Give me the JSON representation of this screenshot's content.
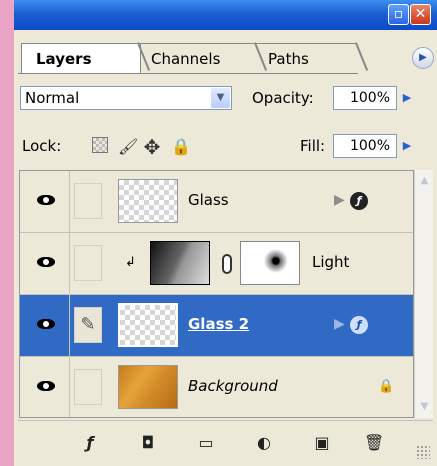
{
  "window": {
    "minimize_icon": "minimize-icon",
    "close_icon": "close-icon",
    "accent": "#0b4bc8"
  },
  "tabs": [
    {
      "label": "Layers",
      "active": true
    },
    {
      "label": "Channels",
      "active": false
    },
    {
      "label": "Paths",
      "active": false
    }
  ],
  "blend_mode": "Normal",
  "opacity": {
    "label": "Opacity:",
    "value": "100%"
  },
  "lock": {
    "label": "Lock:",
    "icons": [
      "lock-transparency-icon",
      "lock-pixels-icon",
      "lock-position-icon",
      "lock-all-icon"
    ]
  },
  "fill": {
    "label": "Fill:",
    "value": "100%"
  },
  "layers": [
    {
      "name": "Glass",
      "visible": true,
      "has_effects": true,
      "selected": false,
      "thumbnail": "transparent"
    },
    {
      "name": "Light",
      "visible": true,
      "has_effects": false,
      "selected": false,
      "thumbnail": "gradient",
      "mask": true,
      "clipped": true
    },
    {
      "name": "Glass 2",
      "visible": true,
      "has_effects": true,
      "selected": true,
      "thumbnail": "transparent",
      "brush_linked": true
    },
    {
      "name": "Background",
      "visible": true,
      "has_effects": false,
      "selected": false,
      "thumbnail": "wood",
      "locked": true
    }
  ],
  "bottom_buttons": [
    "add-layer-style-icon",
    "add-mask-icon",
    "new-group-icon",
    "new-adjustment-layer-icon",
    "new-layer-icon",
    "delete-layer-icon"
  ],
  "colors": {
    "selection": "#316ac5",
    "panel_bg": "#ece9d8",
    "page_bg": "#e9a3c5"
  }
}
